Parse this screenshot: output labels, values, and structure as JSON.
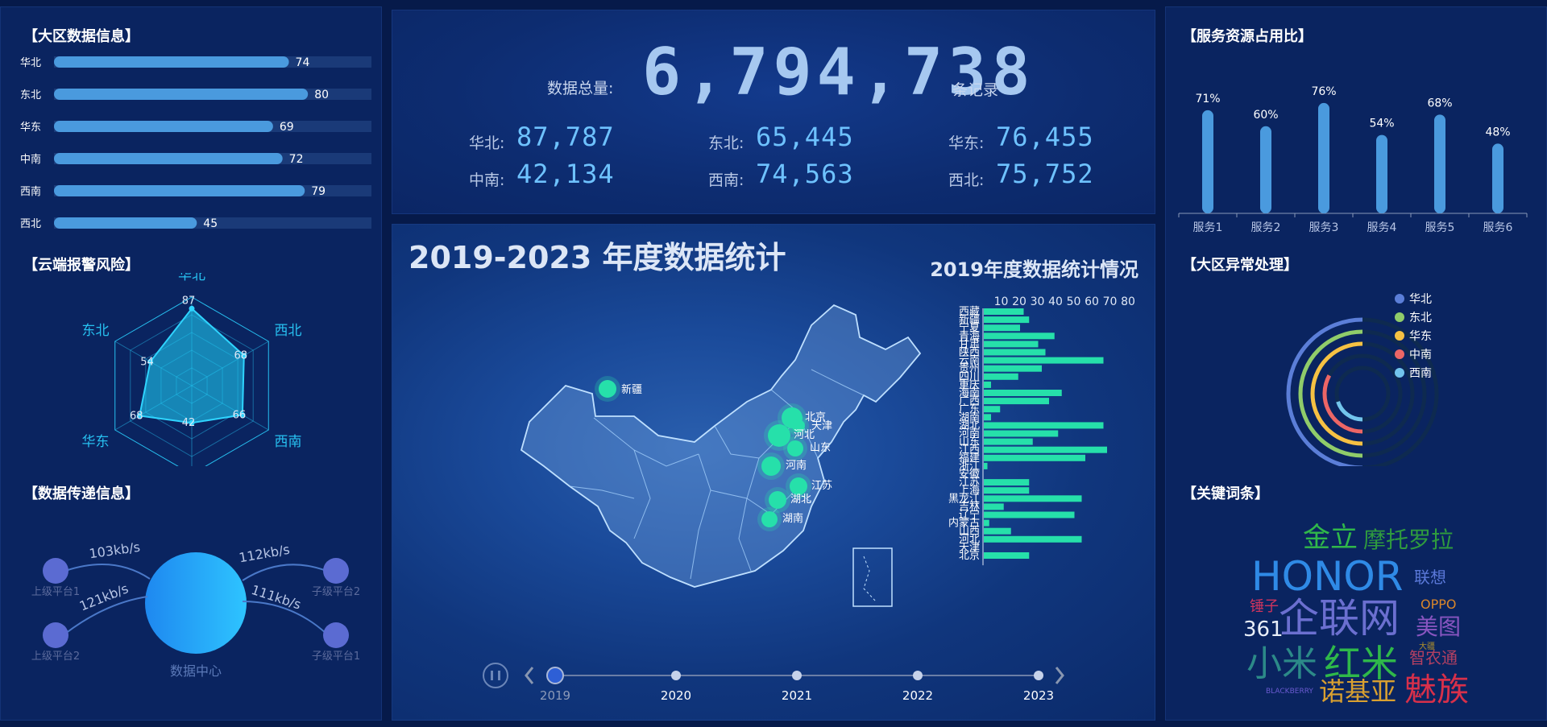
{
  "left": {
    "region_info": {
      "title": "【大区数据信息】",
      "max": 100,
      "items": [
        {
          "label": "华北",
          "value": 74
        },
        {
          "label": "东北",
          "value": 80
        },
        {
          "label": "华东",
          "value": 69
        },
        {
          "label": "中南",
          "value": 72
        },
        {
          "label": "西南",
          "value": 79
        },
        {
          "label": "西北",
          "value": 45
        }
      ]
    },
    "cloud_alarm": {
      "title": "【云端报警风险】",
      "axes": [
        "华北",
        "西北",
        "西南",
        "中南",
        "华东",
        "东北"
      ],
      "values": [
        87,
        68,
        66,
        42,
        68,
        54
      ],
      "max": 100
    },
    "transfer": {
      "title": "【数据传递信息】",
      "center_label": "数据中心",
      "nodes": [
        {
          "label": "上级平台1"
        },
        {
          "label": "上级平台2"
        },
        {
          "label": "子级平台2"
        },
        {
          "label": "子级平台1"
        }
      ],
      "rates": [
        "103kb/s",
        "121kb/s",
        "112kb/s",
        "111kb/s"
      ]
    }
  },
  "top": {
    "total_label": "数据总量:",
    "total_value": "6,794,738",
    "total_unit": "条记录",
    "regions": [
      {
        "label": "华北:",
        "value": "87,787"
      },
      {
        "label": "东北:",
        "value": "65,445"
      },
      {
        "label": "华东:",
        "value": "76,455"
      },
      {
        "label": "中南:",
        "value": "42,134"
      },
      {
        "label": "西南:",
        "value": "74,563"
      },
      {
        "label": "西北:",
        "value": "75,752"
      }
    ]
  },
  "map": {
    "title": "2019-2023 年度数据统计",
    "subtitle": "2019年度数据统计情况",
    "markers": [
      "新疆",
      "北京",
      "天津",
      "河北",
      "山东",
      "河南",
      "江苏",
      "湖北",
      "湖南"
    ],
    "timeline": [
      "2019",
      "2020",
      "2021",
      "2022",
      "2023"
    ],
    "active_year": "2019"
  },
  "chart_data": [
    {
      "type": "bar",
      "orientation": "horizontal",
      "title": "2019年度数据统计情况",
      "xticks": [
        10,
        20,
        30,
        40,
        50,
        60,
        70,
        80
      ],
      "xlim": [
        0,
        80
      ],
      "categories": [
        "西藏",
        "新疆",
        "宁夏",
        "青海",
        "甘肃",
        "陕西",
        "云南",
        "贵州",
        "四川",
        "重庆",
        "海南",
        "广西",
        "广东",
        "湖南",
        "湖北",
        "河南",
        "山东",
        "江西",
        "福建",
        "浙江",
        "安徽",
        "江苏",
        "上海",
        "黑龙江",
        "吉林",
        "辽宁",
        "内蒙古",
        "山西",
        "河北",
        "天津",
        "北京"
      ],
      "values": [
        22,
        25,
        20,
        39,
        30,
        34,
        66,
        32,
        19,
        4,
        43,
        36,
        9,
        4,
        66,
        41,
        27,
        68,
        56,
        2,
        0,
        25,
        25,
        54,
        11,
        50,
        3,
        15,
        54,
        0,
        25
      ]
    },
    {
      "type": "bar",
      "title": "【服务资源占用比】",
      "categories": [
        "服务1",
        "服务2",
        "服务3",
        "服务4",
        "服务5",
        "服务6"
      ],
      "values": [
        71,
        60,
        76,
        54,
        68,
        48
      ],
      "value_suffix": "%",
      "ylim": [
        0,
        80
      ]
    },
    {
      "type": "radial-bar",
      "title": "【大区异常处理】",
      "series": [
        {
          "name": "华北",
          "value": 0.5,
          "color": "#5b7ed8"
        },
        {
          "name": "东北",
          "value": 0.5,
          "color": "#90cc6a"
        },
        {
          "name": "华东",
          "value": 0.5,
          "color": "#f6c143"
        },
        {
          "name": "中南",
          "value": 0.33,
          "color": "#ec6666"
        },
        {
          "name": "西南",
          "value": 0.2,
          "color": "#72c4ec"
        }
      ]
    }
  ],
  "right": {
    "keywords": {
      "title": "【关键词条】",
      "words": [
        {
          "text": "金立",
          "color": "#30b84a",
          "size": 34
        },
        {
          "text": "摩托罗拉",
          "color": "#2f9b3e",
          "size": 28
        },
        {
          "text": "HONOR",
          "color": "#2f8ae6",
          "size": 50
        },
        {
          "text": "联想",
          "color": "#5a78d8",
          "size": 20
        },
        {
          "text": "锤子",
          "color": "#d0345e",
          "size": 18
        },
        {
          "text": "OPPO",
          "color": "#d9862a",
          "size": 16
        },
        {
          "text": "361",
          "color": "#e8eef8",
          "size": 26
        },
        {
          "text": "企联网",
          "color": "#6b6fd0",
          "size": 50
        },
        {
          "text": "美图",
          "color": "#8855c0",
          "size": 28
        },
        {
          "text": "大疆",
          "color": "#b0902a",
          "size": 10
        },
        {
          "text": "小米",
          "color": "#2c8a88",
          "size": 44
        },
        {
          "text": "红米",
          "color": "#2fb84a",
          "size": 46
        },
        {
          "text": "智农通",
          "color": "#b34062",
          "size": 20
        },
        {
          "text": "BLACKBERRY",
          "color": "#6a5ad0",
          "size": 9
        },
        {
          "text": "诺基亚",
          "color": "#d9a030",
          "size": 32
        },
        {
          "text": "魅族",
          "color": "#d8304a",
          "size": 40
        }
      ]
    }
  }
}
